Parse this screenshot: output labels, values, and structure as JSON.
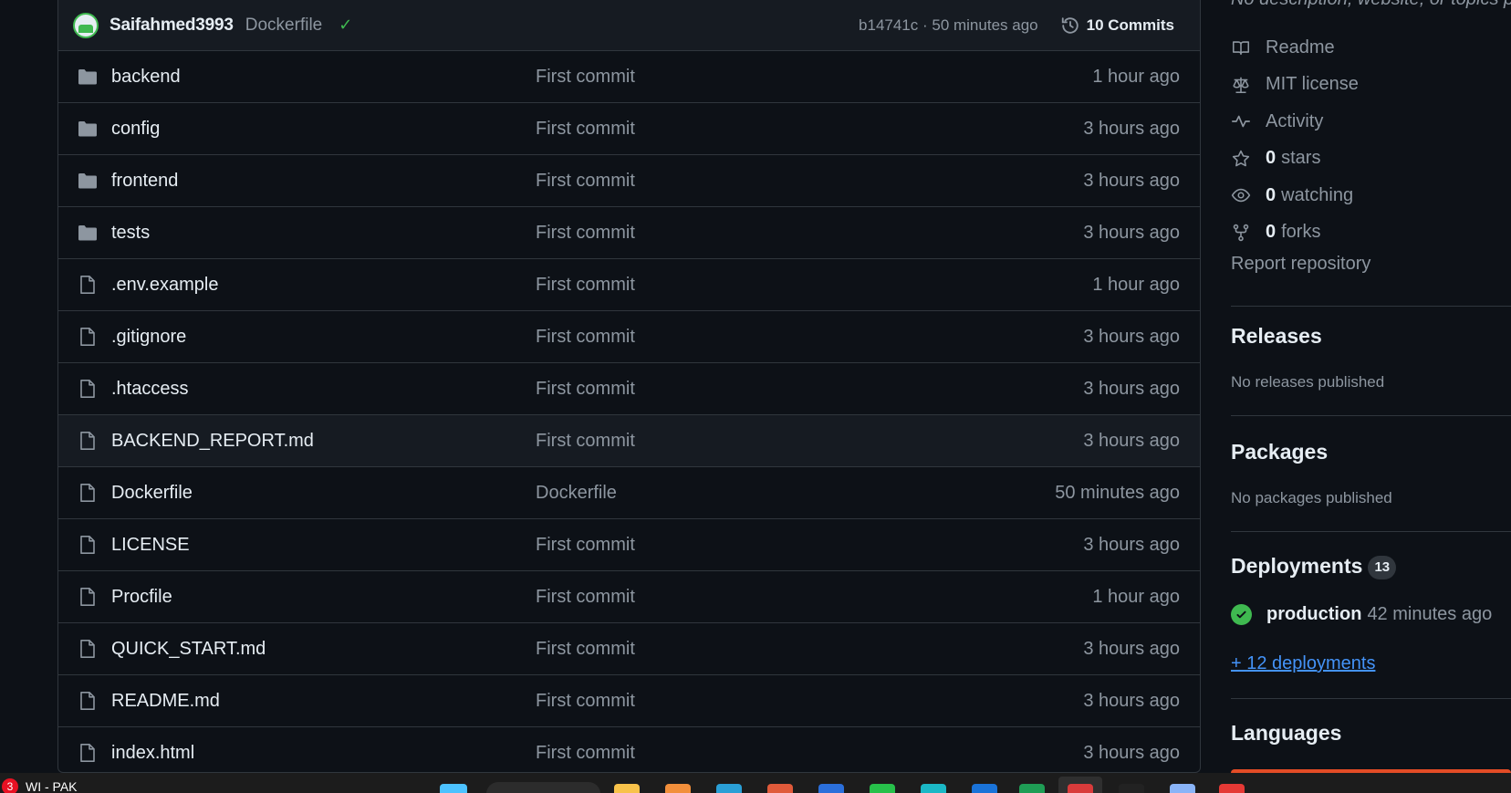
{
  "commit_header": {
    "author": "Saifahmed3993",
    "message": "Dockerfile",
    "meta": "b14741c · 50 minutes ago",
    "commits_label": "10 Commits"
  },
  "files": [
    {
      "type": "folder",
      "name": "backend",
      "message": "First commit",
      "time": "1 hour ago"
    },
    {
      "type": "folder",
      "name": "config",
      "message": "First commit",
      "time": "3 hours ago"
    },
    {
      "type": "folder",
      "name": "frontend",
      "message": "First commit",
      "time": "3 hours ago"
    },
    {
      "type": "folder",
      "name": "tests",
      "message": "First commit",
      "time": "3 hours ago"
    },
    {
      "type": "file",
      "name": ".env.example",
      "message": "First commit",
      "time": "1 hour ago"
    },
    {
      "type": "file",
      "name": ".gitignore",
      "message": "First commit",
      "time": "3 hours ago"
    },
    {
      "type": "file",
      "name": ".htaccess",
      "message": "First commit",
      "time": "3 hours ago"
    },
    {
      "type": "file",
      "name": "BACKEND_REPORT.md",
      "message": "First commit",
      "time": "3 hours ago",
      "hovered": true
    },
    {
      "type": "file",
      "name": "Dockerfile",
      "message": "Dockerfile",
      "time": "50 minutes ago"
    },
    {
      "type": "file",
      "name": "LICENSE",
      "message": "First commit",
      "time": "3 hours ago"
    },
    {
      "type": "file",
      "name": "Procfile",
      "message": "First commit",
      "time": "1 hour ago"
    },
    {
      "type": "file",
      "name": "QUICK_START.md",
      "message": "First commit",
      "time": "3 hours ago"
    },
    {
      "type": "file",
      "name": "README.md",
      "message": "First commit",
      "time": "3 hours ago"
    },
    {
      "type": "file",
      "name": "index.html",
      "message": "First commit",
      "time": "3 hours ago"
    }
  ],
  "sidebar": {
    "about_description": "No description, website, or topics provided.",
    "about_items": [
      {
        "icon": "book-icon",
        "bold": "",
        "label": "Readme"
      },
      {
        "icon": "law-icon",
        "bold": "",
        "label": "MIT license"
      },
      {
        "icon": "pulse-icon",
        "bold": "",
        "label": "Activity"
      },
      {
        "icon": "star-icon",
        "bold": "0",
        "label": "stars"
      },
      {
        "icon": "eye-icon",
        "bold": "0",
        "label": "watching"
      },
      {
        "icon": "fork-icon",
        "bold": "0",
        "label": "forks"
      }
    ],
    "report": "Report repository",
    "releases": {
      "title": "Releases",
      "subtitle": "No releases published"
    },
    "packages": {
      "title": "Packages",
      "subtitle": "No packages published"
    },
    "deployments": {
      "title": "Deployments",
      "count": "13",
      "env_name": "production",
      "env_time": "42 minutes ago",
      "more": "+ 12 deployments"
    },
    "languages": {
      "title": "Languages"
    }
  },
  "taskbar": {
    "badge": "3",
    "weather": "WI - PAK"
  },
  "colors": {
    "background": "#0d1117",
    "success": "#3fb950",
    "link": "#4493f8",
    "muted": "#8d96a0"
  }
}
